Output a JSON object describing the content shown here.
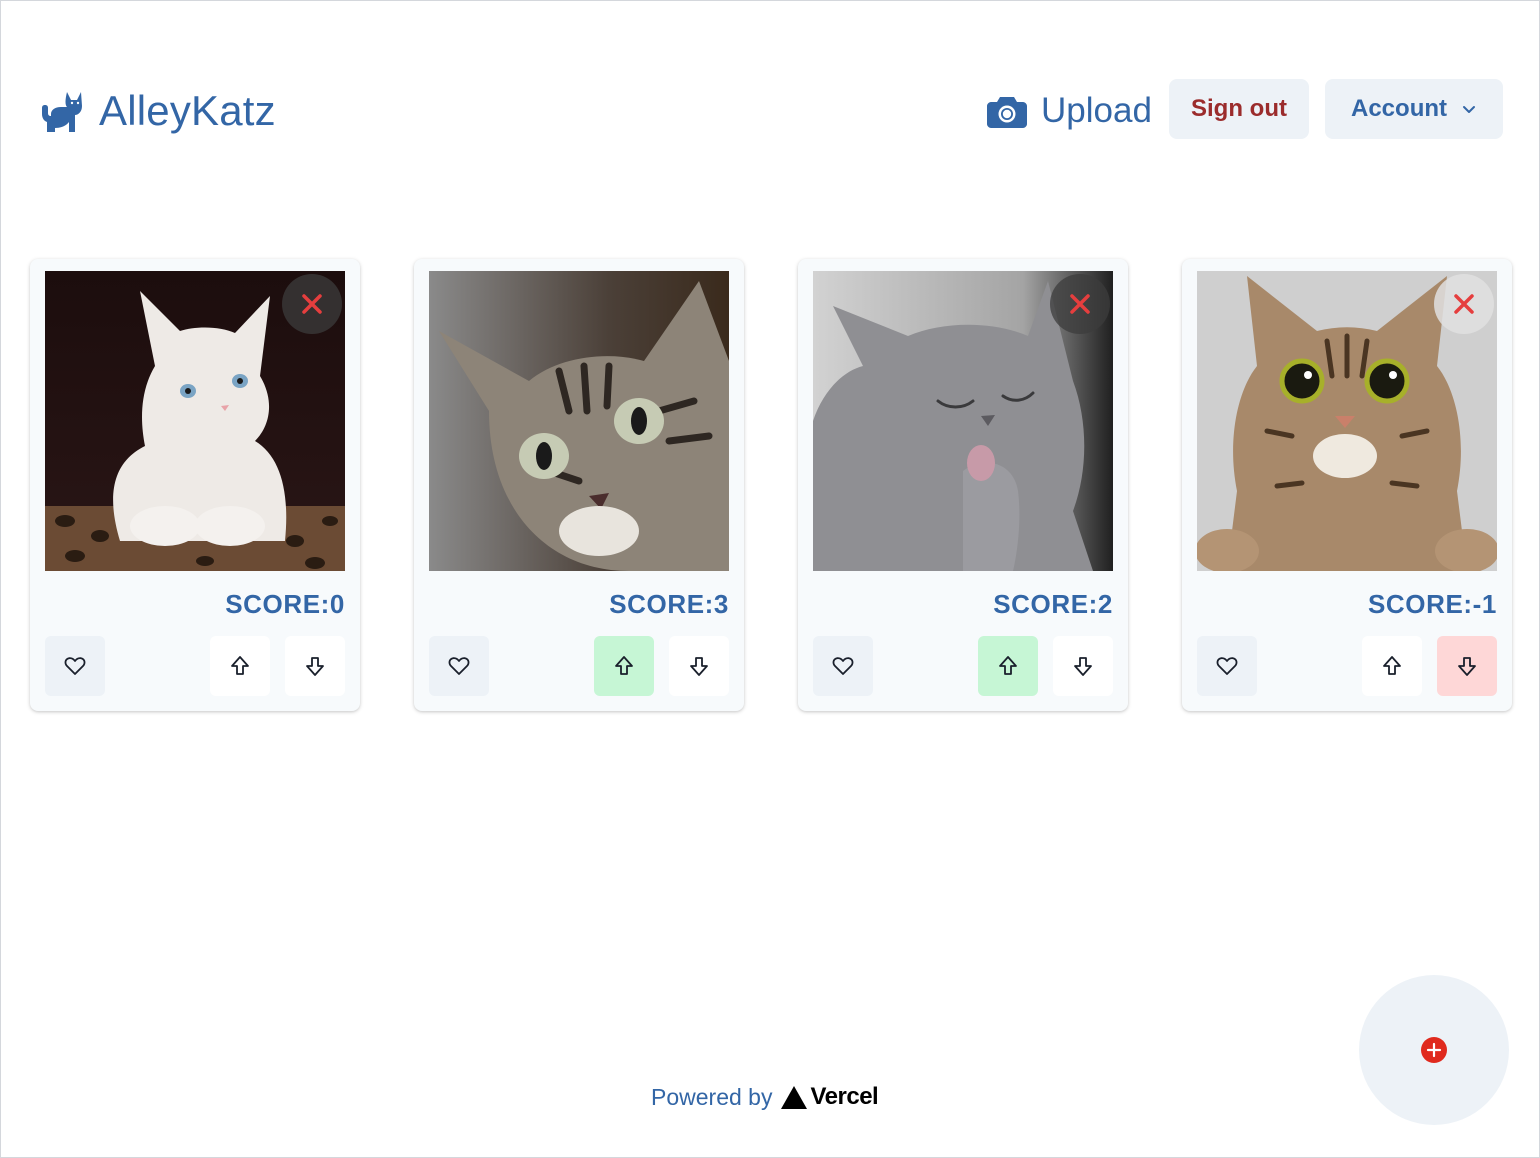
{
  "header": {
    "brand": "AlleyKatz",
    "upload_label": "Upload",
    "signout_label": "Sign out",
    "account_label": "Account"
  },
  "colors": {
    "brand": "#3366a6",
    "danger_text": "#9b2c2c",
    "delete_x": "#e53e3e",
    "upvote_active_bg": "#c6f6d5",
    "downvote_active_bg": "#fed7d7",
    "button_bg": "#edf2f7"
  },
  "cards": [
    {
      "score": "SCORE:0",
      "photo": "white-kitten-photo",
      "deletable": true,
      "vote": "none"
    },
    {
      "score": "SCORE:3",
      "photo": "tabby-kitten-photo",
      "deletable": false,
      "vote": "up"
    },
    {
      "score": "SCORE:2",
      "photo": "grey-cat-photo",
      "deletable": true,
      "vote": "up"
    },
    {
      "score": "SCORE:-1",
      "photo": "tabby-cat-photo",
      "deletable": true,
      "vote": "down"
    }
  ],
  "icons": {
    "brand": "cat-icon",
    "upload": "camera-icon",
    "account_menu": "chevron-down-icon",
    "delete": "close-icon",
    "favorite": "heart-icon",
    "upvote": "arrow-up-icon",
    "downvote": "arrow-down-icon",
    "fab": "plus-circle-icon"
  },
  "footer": {
    "prefix": "Powered by",
    "vercel": "Vercel"
  }
}
